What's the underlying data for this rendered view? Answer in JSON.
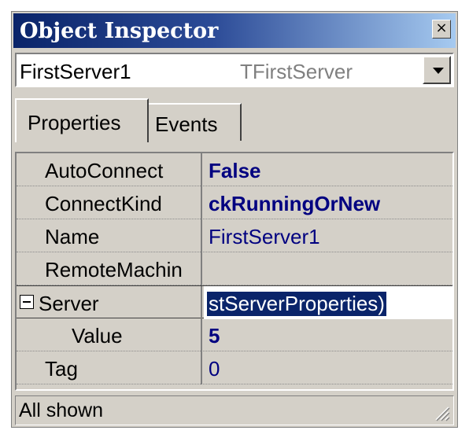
{
  "window": {
    "title": "Object Inspector",
    "close_glyph": "×"
  },
  "component_selector": {
    "name": "FirstServer1",
    "type": "TFirstServer"
  },
  "tabs": [
    {
      "label": "Properties",
      "active": true
    },
    {
      "label": "Events",
      "active": false
    }
  ],
  "properties": [
    {
      "name": "AutoConnect",
      "value": "False"
    },
    {
      "name": "ConnectKind",
      "value": "ckRunningOrNew"
    },
    {
      "name": "Name",
      "value": "FirstServer1"
    },
    {
      "name": "RemoteMachin",
      "value": ""
    },
    {
      "name": "Server",
      "value": "stServerProperties)"
    },
    {
      "name": "Value",
      "value": "5"
    },
    {
      "name": "Tag",
      "value": "0"
    }
  ],
  "status": {
    "text": "All shown"
  },
  "colors": {
    "title_start": "#0a246a",
    "title_end": "#a6caf0",
    "value_text": "#000080",
    "selection": "#0a246a",
    "face": "#d4d0c8"
  },
  "icons": [
    "close-icon",
    "dropdown-arrow-icon",
    "collapse-icon",
    "resize-grip-icon"
  ]
}
